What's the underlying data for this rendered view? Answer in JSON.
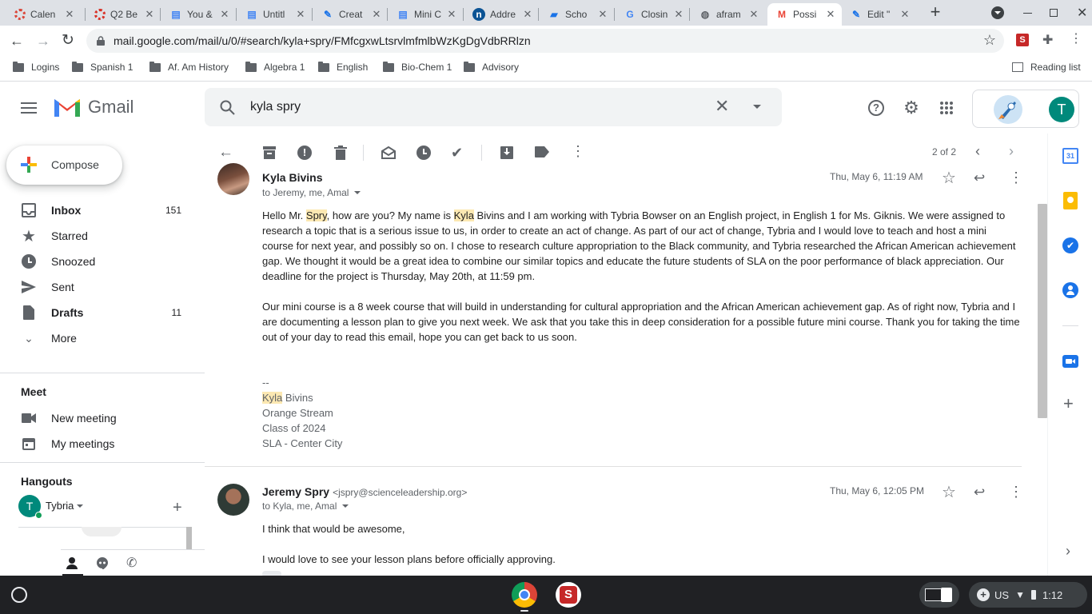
{
  "browser": {
    "tabs": [
      {
        "title": "Calen",
        "icon": "calendar-icon",
        "color": "#db4437"
      },
      {
        "title": "Q2 Be",
        "icon": "target-icon",
        "color": "#d93025"
      },
      {
        "title": "You &",
        "icon": "docs-icon",
        "color": "#4285f4"
      },
      {
        "title": "Untitl",
        "icon": "docs-icon",
        "color": "#4285f4"
      },
      {
        "title": "Creat",
        "icon": "edit-icon",
        "color": "#1a73e8"
      },
      {
        "title": "Mini C",
        "icon": "docs-icon",
        "color": "#4285f4"
      },
      {
        "title": "Addre",
        "icon": "n-icon",
        "color": "#0b5394"
      },
      {
        "title": "Scho",
        "icon": "school-icon",
        "color": "#1a73e8"
      },
      {
        "title": "Closin",
        "icon": "google-icon",
        "color": "#4285f4"
      },
      {
        "title": "afram",
        "icon": "globe-icon",
        "color": "#5f6368"
      },
      {
        "title": "Possi",
        "icon": "gmail-icon",
        "color": "#ea4335"
      },
      {
        "title": "Edit \"",
        "icon": "edit-icon",
        "color": "#1a73e8"
      }
    ],
    "url": "mail.google.com/mail/u/0/#search/kyla+spry/FMfcgxwLtsrvlmfmlbWzKgDgVdbRRlzn",
    "bookmarks": [
      "Logins",
      "Spanish 1",
      "Af. Am History",
      "Algebra 1",
      "English",
      "Bio-Chem 1",
      "Advisory"
    ],
    "reading_list": "Reading list"
  },
  "gmail": {
    "logo": "Gmail",
    "search_query": "kyla spry",
    "avatar_letter": "T",
    "compose": "Compose",
    "nav": [
      {
        "label": "Inbox",
        "count": "151",
        "bold": true
      },
      {
        "label": "Starred",
        "count": "",
        "bold": false
      },
      {
        "label": "Snoozed",
        "count": "",
        "bold": false
      },
      {
        "label": "Sent",
        "count": "",
        "bold": false
      },
      {
        "label": "Drafts",
        "count": "11",
        "bold": true
      },
      {
        "label": "More",
        "count": "",
        "bold": false
      }
    ],
    "meet": {
      "heading": "Meet",
      "new_meeting": "New meeting",
      "my_meetings": "My meetings"
    },
    "hangouts": {
      "heading": "Hangouts",
      "user": "Tybria",
      "avatar": "T"
    },
    "pagination": "2 of 2",
    "messages": [
      {
        "sender": "Kyla Bivins",
        "email": "",
        "recipients": "to Jeremy, me, Amal",
        "date": "Thu, May 6, 11:19 AM"
      },
      {
        "sender": "Jeremy Spry",
        "email": "<jspry@scienceleadership.org>",
        "recipients": "to Kyla, me, Amal",
        "date": "Thu, May 6, 12:05 PM",
        "line1": "I think that would be awesome,",
        "line2": "I would love to see your lesson plans before officially approving."
      }
    ],
    "email1": {
      "p1_a": "Hello Mr. ",
      "p1_h1": "Spry",
      "p1_b": ", how are you? My name is ",
      "p1_h2": "Kyla",
      "p1_c": " Bivins and I am working with Tybria Bowser on an English project, in English 1 for Ms. Giknis. We were assigned to research a topic that is a serious issue to us, in order to create an act of change. As part of our act of change, Tybria and I would love to teach and host a mini course for next year, and possibly so on. I chose to research culture appropriation to the Black community, and Tybria researched the African American achievement gap. We thought it would be a great idea to combine our similar topics and educate the future students of SLA on the poor performance of black appreciation. Our deadline for the project is Thursday, May 20th, at 11:59 pm.",
      "p2": "Our mini course is a 8 week course that will build in understanding for cultural appropriation and the African American achievement gap. As of right now, Tybria and I are documenting a lesson plan to give you next week. We ask that you take this in deep consideration for a possible future mini course. Thank you for taking the time out of your day to read this email, hope you can get back to us soon.",
      "sig_dash": "--",
      "sig_h": "Kyla",
      "sig_name_rest": " Bivins",
      "sig_l2": "Orange Stream",
      "sig_l3": "Class of 2024",
      "sig_l4": "SLA - Center City"
    }
  },
  "shelf": {
    "locale": "US",
    "time": "1:12"
  }
}
